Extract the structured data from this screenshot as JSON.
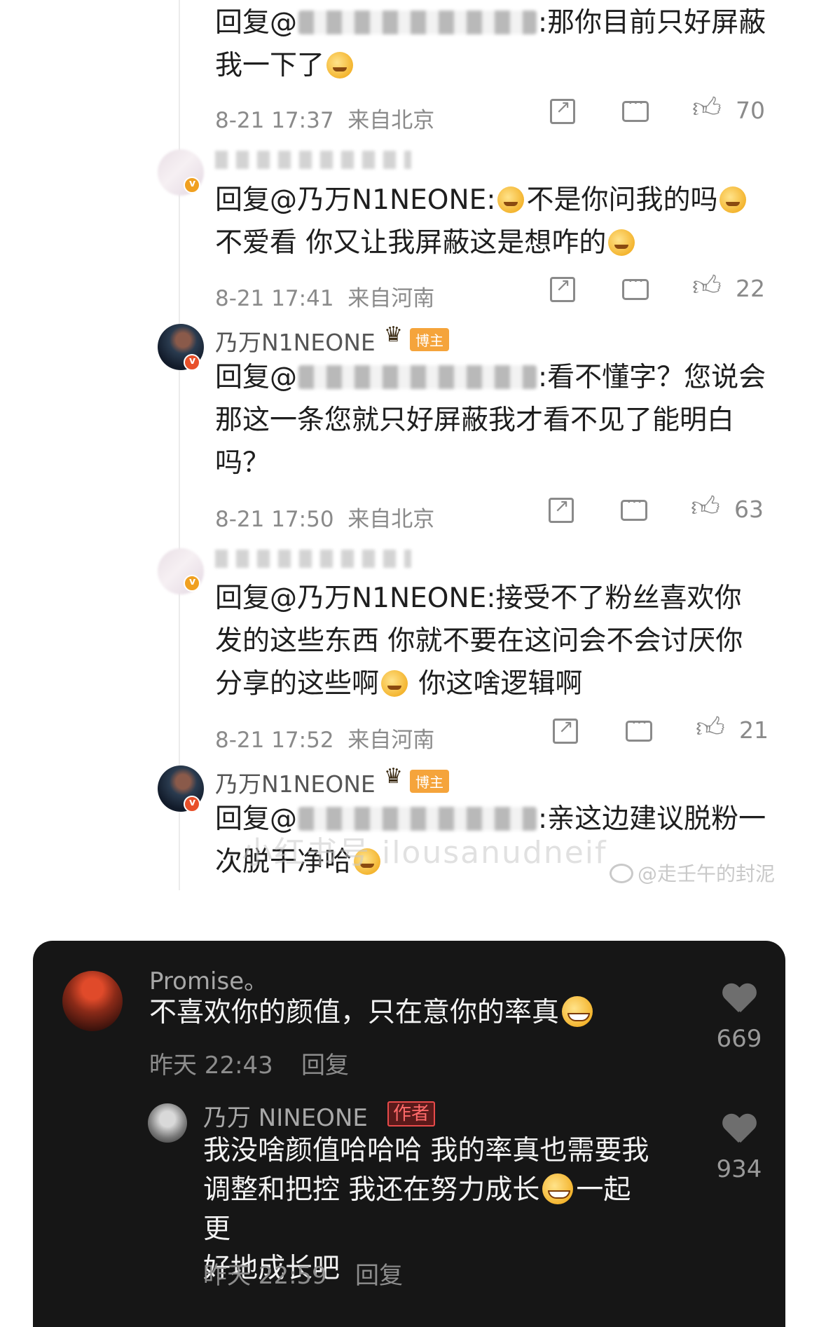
{
  "weibo": {
    "comments": [
      {
        "name": "",
        "text_before": "回复@",
        "text_after": ":那你目前只好屏蔽我一下了",
        "time": "8-21 17:37",
        "location": "来自北京",
        "likes": "70"
      },
      {
        "name": "",
        "text_before": "回复@乃万N1NEONE:",
        "text_middle": "不是你问我的吗",
        "text_after": "不爱看 你又让我屏蔽这是想咋的",
        "time": "8-21 17:41",
        "location": "来自河南",
        "likes": "22"
      },
      {
        "name": "乃万N1NEONE",
        "badge": "博主",
        "text_before": "回复@",
        "text_after": ":看不懂字？您说会那这一条您就只好屏蔽我才看不见了能明白吗？",
        "time": "8-21 17:50",
        "location": "来自北京",
        "likes": "63"
      },
      {
        "name": "",
        "text_before": "回复@乃万N1NEONE:接受不了粉丝喜欢你发的这些东西 你就不要在这问会不会讨厌你分享的这些啊",
        "text_after": " 你这啥逻辑啊",
        "time": "8-21 17:52",
        "location": "来自河南",
        "likes": "21"
      },
      {
        "name": "乃万N1NEONE",
        "badge": "博主",
        "text_before": "回复@",
        "text_after": ":亲这边建议脱粉一次脱干净哈"
      }
    ],
    "watermark": "@走壬午的封泥",
    "ghost_watermark": "小红书号 ilousanudneif"
  },
  "douyin": {
    "comment": {
      "name": "Promise。",
      "text": "不喜欢你的颜值，只在意你的率真",
      "time": "昨天 22:43",
      "reply": "回复",
      "likes": "669"
    },
    "reply": {
      "name": "乃万 NINEONE",
      "tag": "作者",
      "text_line1": "我没啥颜值哈哈哈 我的率真也需要我",
      "text_line2a": "调整和把控 我还在努力成长",
      "text_line2b": "一起更",
      "text_line3": "好地成长吧",
      "time": "昨天 22:59",
      "reply": "回复",
      "likes": "934"
    }
  },
  "colors": {
    "dark_bg": "#161616",
    "blogger_tag": "#f5a43b",
    "author_tag": "#e84a4a"
  }
}
